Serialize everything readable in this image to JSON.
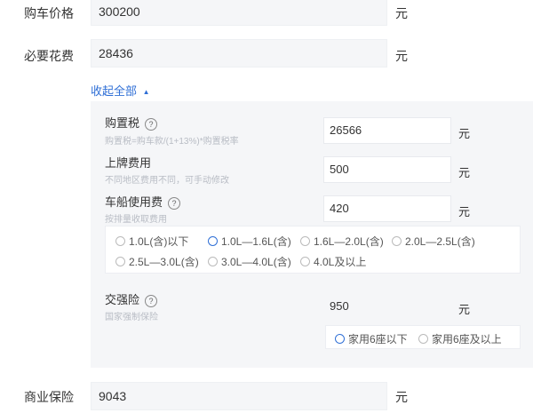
{
  "purchase_price": {
    "label": "购车价格",
    "value": "300200",
    "unit": "元"
  },
  "required_fees": {
    "label": "必要花费",
    "value": "28436",
    "unit": "元"
  },
  "collapse": {
    "label": "收起全部",
    "arrow": "▲"
  },
  "help_icon_glyph": "?",
  "purchase_tax": {
    "label": "购置税",
    "hint": "购置税=购车款/(1+13%)*购置税率",
    "value": "26566",
    "unit": "元"
  },
  "plate_fee": {
    "label": "上牌费用",
    "hint": "不同地区费用不同，可手动修改",
    "value": "500",
    "unit": "元"
  },
  "vehicle_tax": {
    "label": "车船使用费",
    "hint": "按排量收取费用",
    "value": "420",
    "unit": "元",
    "options": [
      "1.0L(含)以下",
      "1.0L—1.6L(含)",
      "1.6L—2.0L(含)",
      "2.0L—2.5L(含)",
      "2.5L—3.0L(含)",
      "3.0L—4.0L(含)",
      "4.0L及以上"
    ],
    "selected_index": 1
  },
  "compulsory_insurance": {
    "label": "交强险",
    "hint": "国家强制保险",
    "value": "950",
    "unit": "元",
    "options": [
      "家用6座以下",
      "家用6座及以上"
    ],
    "selected_index": 0
  },
  "commercial_insurance": {
    "label": "商业保险",
    "value": "9043",
    "unit": "元"
  },
  "colors": {
    "accent": "#2f6fd6",
    "panel": "#f5f6f8"
  }
}
